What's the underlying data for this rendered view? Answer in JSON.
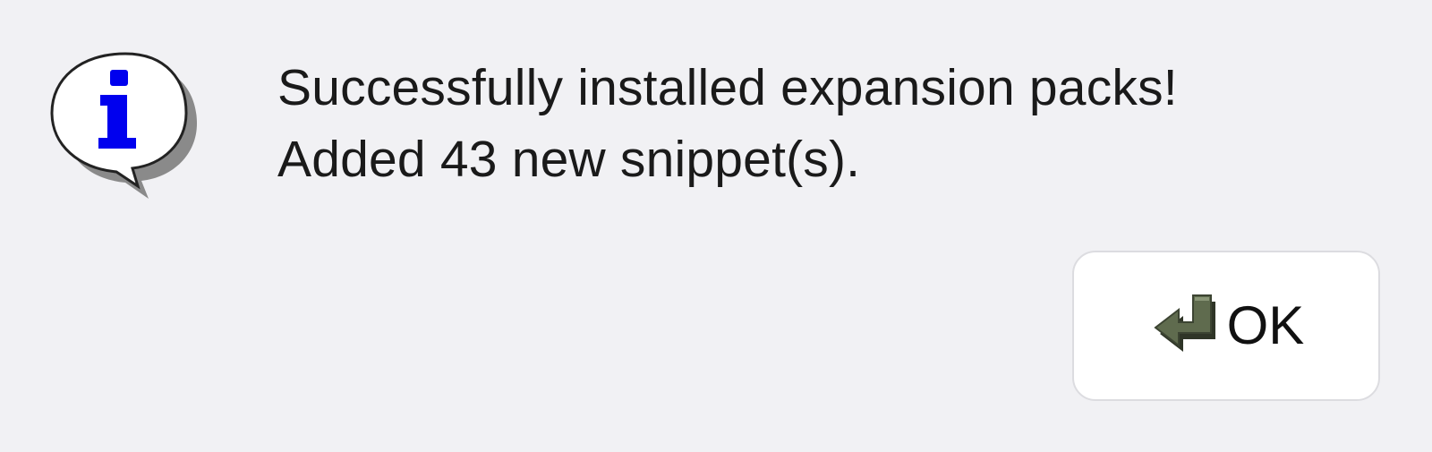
{
  "dialog": {
    "icon": "info-balloon-icon",
    "message_lines": [
      "Successfully installed expansion packs!",
      "Added 43 new snippet(s)."
    ],
    "ok_button": {
      "label": "OK",
      "icon": "enter-arrow-icon"
    }
  },
  "colors": {
    "background": "#f1f1f4",
    "info_letter": "#0000ee",
    "enter_arrow": "#5f6b4e",
    "button_bg": "#ffffff"
  }
}
